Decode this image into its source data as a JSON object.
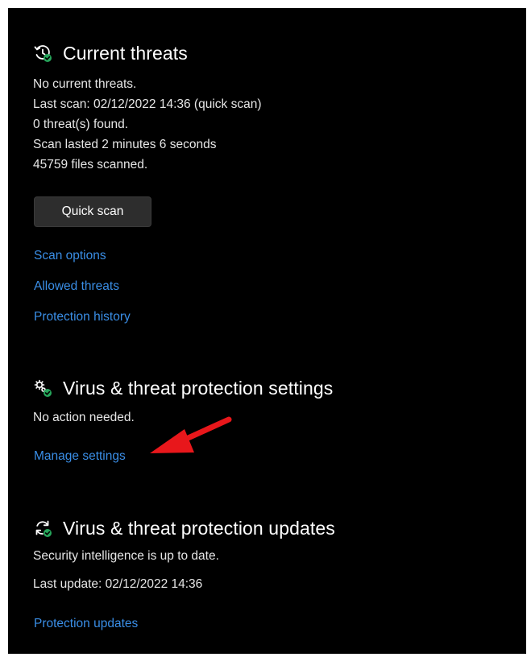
{
  "current_threats": {
    "title": "Current threats",
    "icon": "clock-check-icon",
    "lines": [
      "No current threats.",
      "Last scan: 02/12/2022 14:36 (quick scan)",
      "0 threat(s) found.",
      "Scan lasted 2 minutes 6 seconds",
      "45759 files scanned."
    ],
    "quick_scan_label": "Quick scan",
    "links": {
      "scan_options": "Scan options",
      "allowed_threats": "Allowed threats",
      "protection_history": "Protection history"
    }
  },
  "settings": {
    "title": "Virus & threat protection settings",
    "icon": "gears-check-icon",
    "status": "No action needed.",
    "manage_link": "Manage settings"
  },
  "updates": {
    "title": "Virus & threat protection updates",
    "icon": "refresh-check-icon",
    "status": "Security intelligence is up to date.",
    "last_update": "Last update: 02/12/2022 14:36",
    "link": "Protection updates"
  },
  "colors": {
    "background": "#000000",
    "link": "#3a8ee6",
    "check_badge": "#26a65b",
    "annotation_arrow": "#e8171b"
  }
}
